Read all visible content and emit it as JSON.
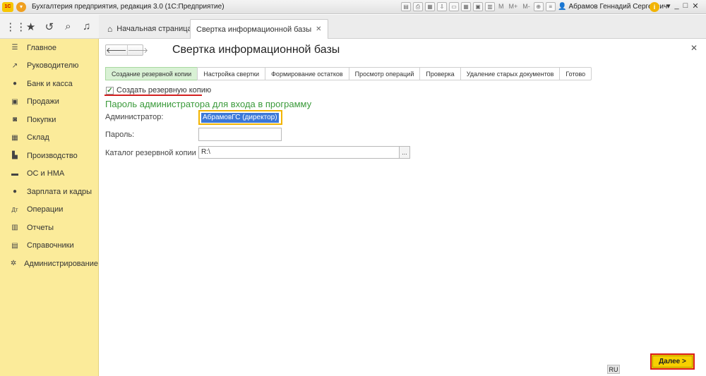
{
  "titlebar": {
    "logo": "1С",
    "title": "Бухгалтерия предприятия, редакция 3.0  (1С:Предприятие)",
    "m_labels": [
      "M",
      "M+",
      "M-"
    ],
    "user": "Абрамов Геннадий Сергеевич",
    "info": "i"
  },
  "tabs": {
    "home": "Начальная страница",
    "active": "Свертка информационной базы"
  },
  "sidebar": {
    "items": [
      {
        "label": "Главное",
        "icon": "menu-lines-icon"
      },
      {
        "label": "Руководителю",
        "icon": "trend-icon"
      },
      {
        "label": "Банк и касса",
        "icon": "ruble-icon"
      },
      {
        "label": "Продажи",
        "icon": "cart-icon"
      },
      {
        "label": "Покупки",
        "icon": "basket-icon"
      },
      {
        "label": "Склад",
        "icon": "warehouse-icon"
      },
      {
        "label": "Производство",
        "icon": "factory-icon"
      },
      {
        "label": "ОС и НМА",
        "icon": "truck-icon"
      },
      {
        "label": "Зарплата и кадры",
        "icon": "person-icon"
      },
      {
        "label": "Операции",
        "icon": "dt-kt-icon"
      },
      {
        "label": "Отчеты",
        "icon": "bar-chart-icon"
      },
      {
        "label": "Справочники",
        "icon": "books-icon"
      },
      {
        "label": "Администрирование",
        "icon": "gear-icon"
      }
    ]
  },
  "form": {
    "title": "Свертка информационной базы",
    "steps": [
      "Создание резервной копии",
      "Настройка свертки",
      "Формирование остатков",
      "Просмотр операций",
      "Проверка",
      "Удаление старых документов",
      "Готово"
    ],
    "backup_checkbox": "Создать резервную копию",
    "section_title": "Пароль администратора для входа в программу",
    "admin_label": "Администратор:",
    "admin_value": "АбрамовГС (директор)",
    "password_label": "Пароль:",
    "catalog_label": "Каталог резервной копии ИБ:",
    "catalog_value": "R:\\",
    "next_button": "Далее >",
    "lang": "RU"
  }
}
